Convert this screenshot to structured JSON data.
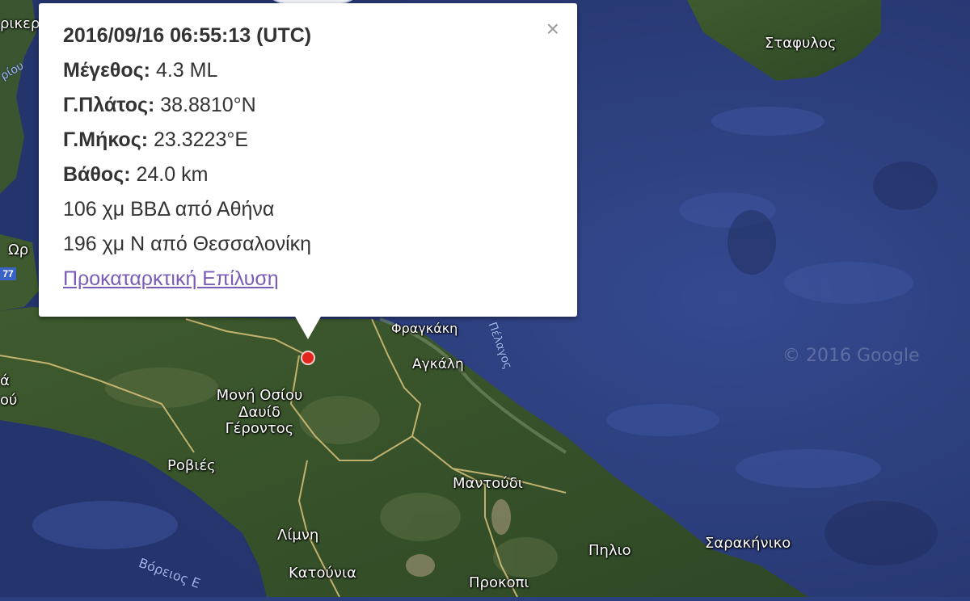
{
  "popup": {
    "title": "2016/09/16 06:55:13 (UTC)",
    "rows": [
      {
        "label": "Μέγεθος:",
        "value": "4.3 ML"
      },
      {
        "label": "Γ.Πλάτος:",
        "value": "38.8810°N"
      },
      {
        "label": "Γ.Μήκος:",
        "value": "23.3223°E"
      },
      {
        "label": "Βάθος:",
        "value": "24.0 km"
      }
    ],
    "distances": [
      "106 χμ ΒΒΔ από Αθήνα",
      "196 χμ Ν από Θεσσαλονίκη"
    ],
    "link": "Προκαταρκτική Επίλυση",
    "close": "×"
  },
  "places": {
    "stafylos": "Σταφυλος",
    "fragkaki": "Φραγκάκη",
    "agkali": "Αγκάλη",
    "moni_line1": "Μονή Οσίου",
    "moni_line2": "Δαυίδ",
    "moni_line3": "Γέροντος",
    "rovies": "Ροβιές",
    "mantoudi": "Μαντούδι",
    "limni": "Λίμνη",
    "katounia": "Κατούνια",
    "prokopi": "Προκοπι",
    "pilio": "Πηλιο",
    "sarakiniko": "Σαρακήνικο",
    "left_ore": "Ωρ",
    "left_top": "ρικερ",
    "left_mid1": "ά",
    "left_mid2": "ού"
  },
  "water": {
    "voreios": "Βόρειος Ε",
    "pelagos": "Πέλαγος",
    "top_left": "ρίου"
  },
  "map": {
    "route_badge": "77",
    "watermark": "© 2016 Google"
  },
  "colors": {
    "marker": "#e3261d",
    "link": "#7a5cb8",
    "sea": "#2c3f7e"
  }
}
